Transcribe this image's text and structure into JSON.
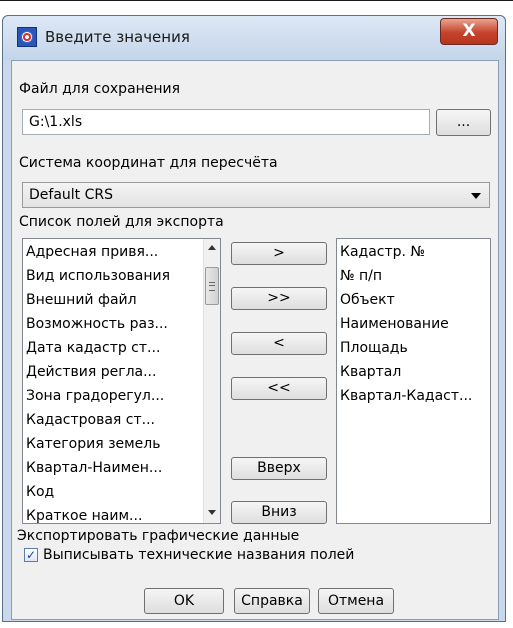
{
  "window": {
    "title": "Введите значения",
    "close_label": "X"
  },
  "save_file": {
    "label": "Файл для сохранения",
    "value": "G:\\1.xls",
    "browse_label": "..."
  },
  "crs": {
    "label": "Система координат для пересчёта",
    "selected": "Default CRS"
  },
  "fields": {
    "label": "Список полей для экспорта",
    "available": [
      "Адресная привя...",
      "Вид использования",
      "Внешний файл",
      "Возможность раз...",
      "Дата кадастр ст...",
      "Действия регла...",
      "Зона градорегул...",
      "Кадастровая ст...",
      "Категория земель",
      "Квартал-Наимен...",
      "Код",
      "Краткое наим..."
    ],
    "selected": [
      "Кадастр. №",
      "№ п/п",
      "Объект",
      "Наименование",
      "Площадь",
      "Квартал",
      "Квартал-Кадаст..."
    ],
    "buttons": {
      "add": ">",
      "add_all": ">>",
      "remove": "<",
      "remove_all": "<<",
      "up": "Вверх",
      "down": "Вниз"
    }
  },
  "options": {
    "export_graphics": "Экспортировать графические данные",
    "technical_names": "Выписывать технические названия полей",
    "technical_names_checked": true
  },
  "footer": {
    "ok": "OK",
    "help": "Справка",
    "cancel": "Отмена"
  }
}
